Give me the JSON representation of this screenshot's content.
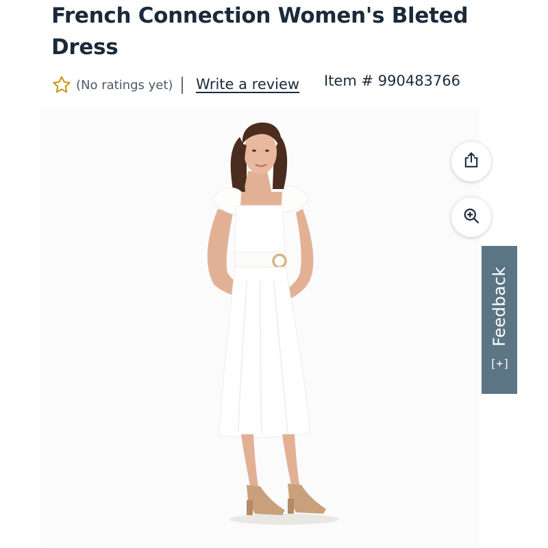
{
  "product": {
    "title": "French Connection Women's Bleted Dress",
    "ratings_text": "(No ratings yet)",
    "write_review_label": "Write a review",
    "item_number_text": "Item # 990483766"
  },
  "icons": {
    "rating_star": "star-outline-icon",
    "share": "share-icon",
    "zoom": "zoom-in-icon",
    "feedback": "feedback-plus-icon"
  },
  "feedback": {
    "label": "Feedback",
    "icon_glyph": "[+]"
  },
  "colors": {
    "title_text": "#1b2a3a",
    "star_gold": "#c99a16",
    "feedback_tab_bg": "#5c7584"
  }
}
